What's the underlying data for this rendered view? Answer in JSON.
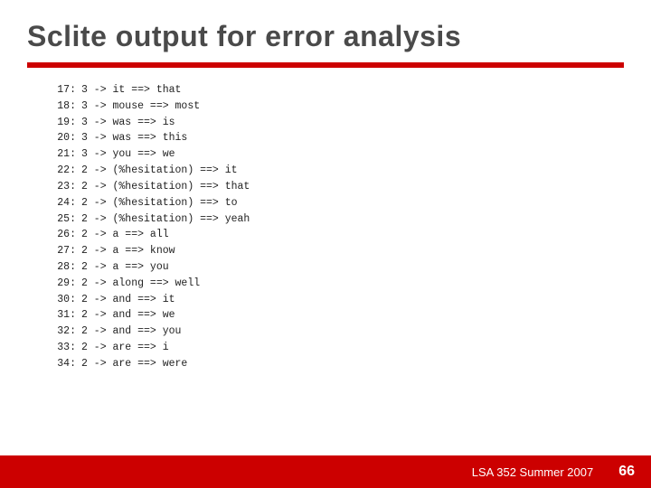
{
  "title": "Sclite output for error analysis",
  "lines": [
    {
      "num": "17:",
      "content": "3 ->  it ==> that"
    },
    {
      "num": "18:",
      "content": "3 ->  mouse ==> most"
    },
    {
      "num": "19:",
      "content": "3 ->  was ==> is"
    },
    {
      "num": "20:",
      "content": "3 ->  was ==> this"
    },
    {
      "num": "21:",
      "content": "3 ->  you ==> we"
    },
    {
      "num": "22:",
      "content": "2 ->  (%hesitation) ==> it"
    },
    {
      "num": "23:",
      "content": "2 ->  (%hesitation) ==> that"
    },
    {
      "num": "24:",
      "content": "2 ->  (%hesitation) ==> to"
    },
    {
      "num": "25:",
      "content": "2 ->  (%hesitation) ==> yeah"
    },
    {
      "num": "26:",
      "content": "2 ->  a ==> all"
    },
    {
      "num": "27:",
      "content": "2 ->  a ==> know"
    },
    {
      "num": "28:",
      "content": "2 ->  a ==> you"
    },
    {
      "num": "29:",
      "content": "2 ->  along ==> well"
    },
    {
      "num": "30:",
      "content": "2 ->  and ==> it"
    },
    {
      "num": "31:",
      "content": "2 ->  and ==> we"
    },
    {
      "num": "32:",
      "content": "2 ->  and ==> you"
    },
    {
      "num": "33:",
      "content": "2 ->  are ==> i"
    },
    {
      "num": "34:",
      "content": "2 ->  are ==> were"
    }
  ],
  "footer": {
    "label": "LSA 352 Summer 2007",
    "page": "66"
  }
}
